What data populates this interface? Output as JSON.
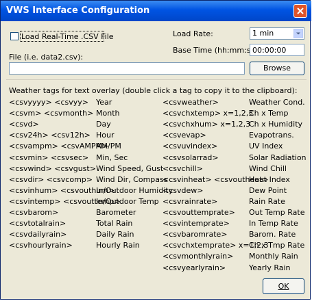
{
  "window": {
    "title": "VWS Interface Configuration"
  },
  "load_realtime": {
    "label": "Load Real-Time .CSV File",
    "checked": false
  },
  "load_rate": {
    "label": "Load Rate:",
    "value": "1 min"
  },
  "base_time": {
    "label": "Base Time (hh:mm:ss):",
    "value": "00:00:00"
  },
  "file": {
    "label": "File (i.e. data2.csv):",
    "value": ""
  },
  "browse_label": "Browse",
  "instructions": "Weather tags for text overlay (double click a tag to copy it to the clipboard):",
  "left_tags": [
    {
      "tag": "<csvyyyy>  <csvyy>",
      "desc": "Year"
    },
    {
      "tag": "<csvm>  <csvmonth>",
      "desc": "Month"
    },
    {
      "tag": "<csvd>",
      "desc": "Day"
    },
    {
      "tag": "<csv24h>  <csv12h>",
      "desc": "Hour"
    },
    {
      "tag": "<csvampm>  <csvAMPM>",
      "desc": "AM/PM"
    },
    {
      "tag": "<csvmin>  <csvsec>",
      "desc": "Min, Sec"
    },
    {
      "tag": "<csvwind>  <csvgust>",
      "desc": "Wind Speed, Gust"
    },
    {
      "tag": "<csvdir>  <csvcomp>",
      "desc": "Wind Dir, Compass"
    },
    {
      "tag": "<csvinhum>  <csvouthum>",
      "desc": "In/Outdoor Humidity"
    },
    {
      "tag": "<csvintemp>  <csvouttemp>",
      "desc": "In/Outdoor Temp"
    },
    {
      "tag": "<csvbarom>",
      "desc": "Barometer"
    },
    {
      "tag": "<csvtotalrain>",
      "desc": "Total Rain"
    },
    {
      "tag": "<csvdailyrain>",
      "desc": "Daily Rain"
    },
    {
      "tag": "<csvhourlyrain>",
      "desc": "Hourly Rain"
    }
  ],
  "right_tags": [
    {
      "tag": "<csvweather>",
      "desc": "Weather Cond."
    },
    {
      "tag": "<csvchxtemp>  x=1,2,3",
      "desc": "Ch x Temp"
    },
    {
      "tag": "<csvchxhum>  x=1,2,3",
      "desc": "Ch x Humidity"
    },
    {
      "tag": "<csvevap>",
      "desc": "Evapotrans."
    },
    {
      "tag": "<csvuvindex>",
      "desc": "UV Index"
    },
    {
      "tag": "<csvsolarrad>",
      "desc": "Solar Radiation"
    },
    {
      "tag": "<csvchill>",
      "desc": "Wind Chill"
    },
    {
      "tag": "<csvinheat>  <csvoutheat>",
      "desc": "Heat Index"
    },
    {
      "tag": "<csvdew>",
      "desc": "Dew Point"
    },
    {
      "tag": "<csvrainrate>",
      "desc": "Rain Rate"
    },
    {
      "tag": "<csvouttemprate>",
      "desc": "Out Temp Rate"
    },
    {
      "tag": "<csvintemprate>",
      "desc": "In Temp Rate"
    },
    {
      "tag": "<csvbaromrate>",
      "desc": "Barom. Rate"
    },
    {
      "tag": "<csvchxtemprate> x=1,2,3",
      "desc": "Ch x Tmp Rate"
    },
    {
      "tag": "<csvmonthlyrain>",
      "desc": "Monthly Rain"
    },
    {
      "tag": "<csvyearlyrain>",
      "desc": "Yearly Rain"
    }
  ],
  "ok_label": "OK"
}
